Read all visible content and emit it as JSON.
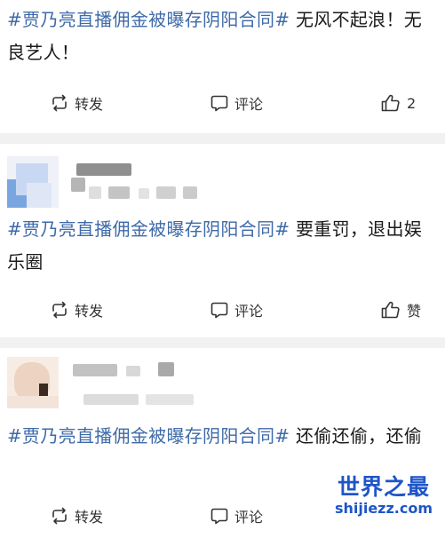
{
  "posts": [
    {
      "tag": "#贾乃亮直播佣金被曝存阴阳合同#",
      "text": " 无风不起浪！无良艺人！",
      "repost_label": "转发",
      "comment_label": "评论",
      "like_label": "2"
    },
    {
      "tag": "#贾乃亮直播佣金被曝存阴阳合同#",
      "text": " 要重罚，退出娱乐圈",
      "repost_label": "转发",
      "comment_label": "评论",
      "like_label": "赞"
    },
    {
      "tag": "#贾乃亮直播佣金被曝存阴阳合同#",
      "text": " 还偷还偷，还偷",
      "repost_label": "转发",
      "comment_label": "评论",
      "like_label": ""
    }
  ],
  "watermark": {
    "title": "世界之最",
    "url": "shijiezz.com"
  },
  "colors": {
    "hashtag": "#3e6aa8",
    "divider": "#f1f1f1",
    "watermark": "#1e55c8"
  }
}
